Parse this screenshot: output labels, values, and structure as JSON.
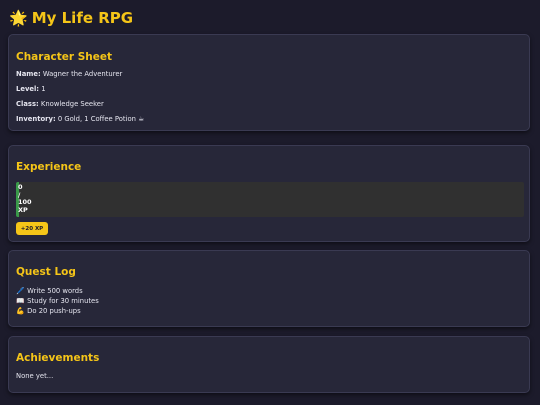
{
  "app": {
    "icon": "🌟",
    "title": "My Life RPG"
  },
  "character": {
    "heading": "Character Sheet",
    "name_label": "Name:",
    "name": "Wagner the Adventurer",
    "level_label": "Level:",
    "level": "1",
    "class_label": "Class:",
    "class": "Knowledge Seeker",
    "inventory_label": "Inventory:",
    "inventory": "0 Gold, 1 Coffee Potion ☕"
  },
  "experience": {
    "heading": "Experience",
    "current": "0",
    "separator": "/",
    "max": "100",
    "unit": "XP",
    "progress_fraction": 0.0,
    "button_label": "+20 XP"
  },
  "quests": {
    "heading": "Quest Log",
    "items": [
      {
        "icon": "🖊️",
        "text": "Write 500 words"
      },
      {
        "icon": "📖",
        "text": "Study for 30 minutes"
      },
      {
        "icon": "💪",
        "text": "Do 20 push-ups"
      }
    ]
  },
  "achievements": {
    "heading": "Achievements",
    "empty_text": "None yet..."
  },
  "colors": {
    "accent": "#f5c518",
    "background": "#1c1b2b",
    "card": "#272739",
    "xp_fill": "#3a9a4a"
  }
}
